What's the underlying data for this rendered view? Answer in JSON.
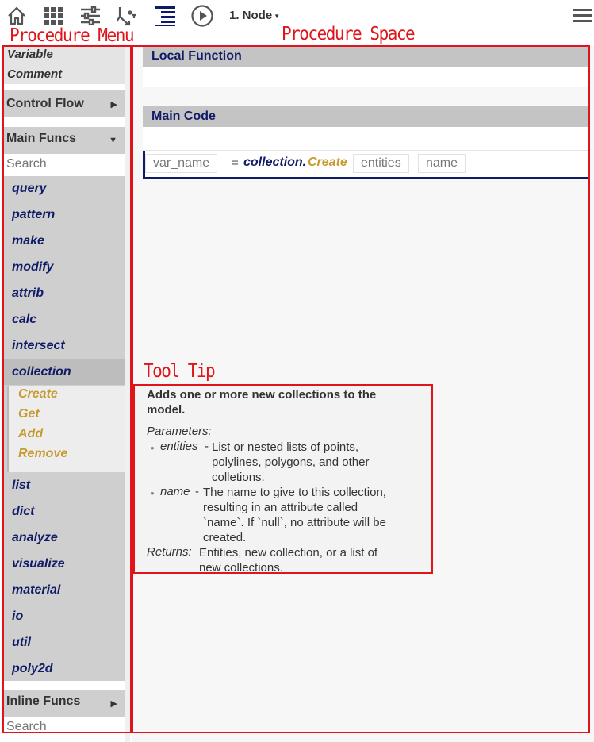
{
  "toolbar": {
    "icons": [
      "home-icon",
      "grid-icon",
      "sliders-icon",
      "flowchart-icon",
      "indent-icon",
      "play-icon",
      "hamburger-icon"
    ],
    "node_label": "1. Node"
  },
  "annotations": {
    "procedure_menu": "Procedure Menu",
    "procedure_space": "Procedure Space",
    "tool_tip": "Tool Tip"
  },
  "menu": {
    "top_items": [
      "Variable",
      "Comment"
    ],
    "control_flow": "Control Flow",
    "main_funcs": "Main Funcs",
    "search_placeholder": "Search",
    "functions": [
      "query",
      "pattern",
      "make",
      "modify",
      "attrib",
      "calc",
      "intersect",
      "collection",
      "list",
      "dict",
      "analyze",
      "visualize",
      "material",
      "io",
      "util",
      "poly2d"
    ],
    "selected_function": "collection",
    "sub_functions": [
      "Create",
      "Get",
      "Add",
      "Remove"
    ],
    "inline_funcs": "Inline Funcs",
    "inline_search_placeholder": "Search"
  },
  "space": {
    "local_function_header": "Local Function",
    "main_code_header": "Main Code",
    "code_line": {
      "var_placeholder": "var_name",
      "equals": "=",
      "module": "collection.",
      "function": "Create",
      "args": [
        "entities",
        "name"
      ]
    }
  },
  "tooltip": {
    "title": "Adds one or more new collections to the model.",
    "parameters_label": "Parameters:",
    "params": [
      {
        "name": "entities",
        "sep": "-",
        "desc_lines": [
          "List or nested lists of points,",
          "polylines, polygons, and other",
          "colletions."
        ]
      },
      {
        "name": "name",
        "sep": "-",
        "desc_lines": [
          "The name to give to this collection,",
          "resulting in an attribute called",
          "`name`. If `null`, no attribute will be",
          "created."
        ]
      }
    ],
    "returns_label": "Returns:",
    "returns_lines": [
      "Entities, new collection, or a list of",
      "new collections."
    ]
  },
  "colors": {
    "annotation_red": "#e0151b",
    "function_navy": "#101b66",
    "sub_function_gold": "#c79a2e",
    "menu_gray": "#cfcfcf"
  }
}
